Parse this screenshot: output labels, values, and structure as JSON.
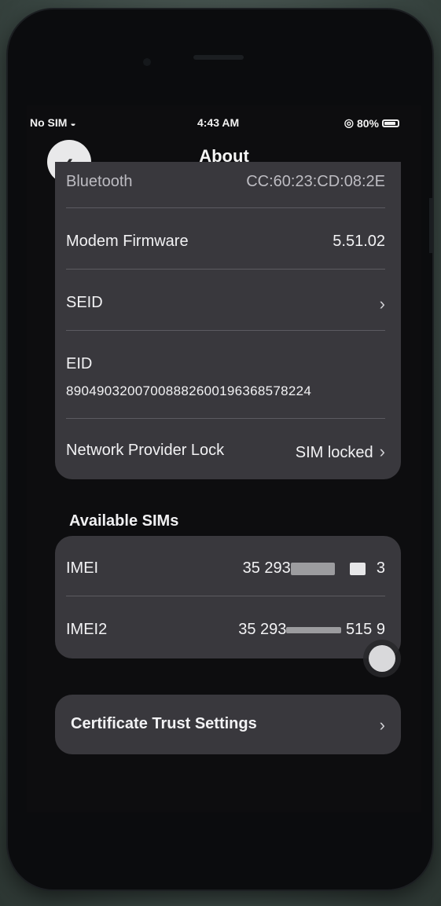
{
  "status_bar": {
    "carrier": "No SIM",
    "time": "4:43 AM",
    "battery": "80%"
  },
  "nav": {
    "title": "About",
    "back_icon": "chevron-left-icon"
  },
  "about_list": {
    "bluetooth": {
      "label": "Bluetooth",
      "value": "CC:60:23:CD:08:2E"
    },
    "modem_firmware": {
      "label": "Modem Firmware",
      "value": "5.51.02"
    },
    "seid": {
      "label": "SEID"
    },
    "eid": {
      "label": "EID",
      "value": "89049032007008882600196368578224"
    },
    "network_provider_lock": {
      "label": "Network Provider Lock",
      "value": "SIM locked"
    }
  },
  "available_sims": {
    "header": "Available SIMs",
    "imei": {
      "label": "IMEI",
      "value_prefix": "35 293",
      "value_suffix": "3"
    },
    "imei2": {
      "label": "IMEI2",
      "value_prefix": "35 293",
      "value_suffix": "515 9"
    }
  },
  "certificate": {
    "label": "Certificate Trust Settings"
  },
  "icons": {
    "chevron": "›",
    "back": "‹"
  }
}
